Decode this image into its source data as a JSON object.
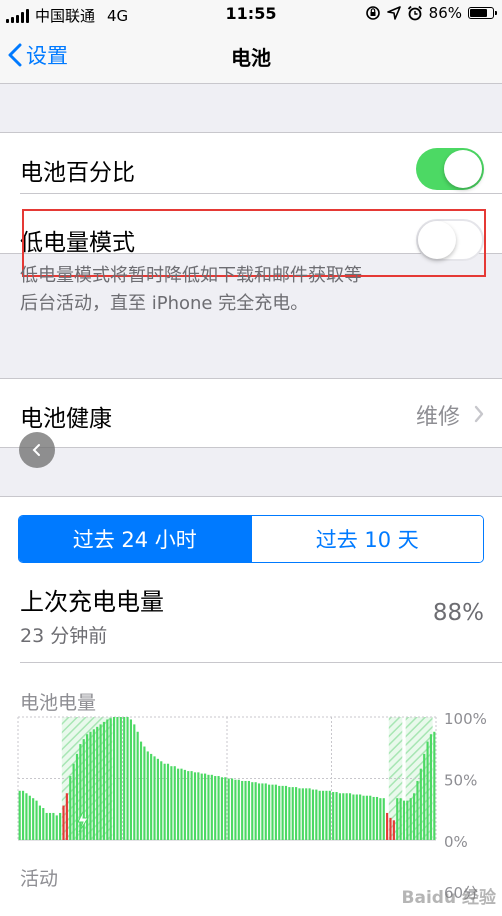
{
  "status_bar": {
    "carrier": "中国联通",
    "network": "4G",
    "time": "11:55",
    "battery_percent": "86%",
    "battery_level": 0.86
  },
  "nav": {
    "back_label": "设置",
    "title": "电池"
  },
  "settings": {
    "battery_percentage_label": "电池百分比",
    "battery_percentage_on": true,
    "low_power_label": "低电量模式",
    "low_power_on": false,
    "low_power_footnote_line1": "低电量模式将暂时降低如下载和邮件获取等",
    "low_power_footnote_line2": "后台活动，直至 iPhone 完全充电。",
    "battery_health_label": "电池健康",
    "battery_health_value": "维修"
  },
  "usage": {
    "segments": [
      "过去 24 小时",
      "过去 10 天"
    ],
    "selected_segment": 0,
    "last_charge_title": "上次充电电量",
    "last_charge_time": "23 分钟前",
    "last_charge_value": "88%",
    "battery_level_label": "电池电量",
    "activity_label": "活动",
    "activity_axis_top": "60分",
    "watermark": "Baidu 经验"
  },
  "colors": {
    "accent": "#007aff",
    "toggle_on": "#4cd964",
    "bar_green": "#4cd964",
    "bar_low": "#e53935",
    "highlight_box": "#e53935"
  },
  "chart_data": {
    "type": "bar",
    "title": "电池电量",
    "y_tick_labels": [
      "100%",
      "50%",
      "0%"
    ],
    "ylim": [
      0,
      100
    ],
    "values": [
      40,
      40,
      38,
      36,
      34,
      32,
      28,
      26,
      22,
      22,
      22,
      20,
      22,
      28,
      38,
      52,
      62,
      70,
      78,
      82,
      86,
      88,
      90,
      92,
      94,
      96,
      98,
      99,
      100,
      100,
      100,
      100,
      100,
      98,
      94,
      88,
      80,
      76,
      72,
      70,
      68,
      66,
      64,
      62,
      62,
      60,
      60,
      58,
      58,
      57,
      56,
      56,
      55,
      55,
      54,
      54,
      53,
      53,
      52,
      52,
      51,
      51,
      50,
      50,
      49,
      49,
      48,
      48,
      48,
      47,
      47,
      46,
      46,
      46,
      45,
      45,
      45,
      44,
      44,
      44,
      43,
      43,
      43,
      42,
      42,
      42,
      42,
      41,
      41,
      40,
      40,
      40,
      40,
      39,
      39,
      38,
      38,
      38,
      38,
      37,
      37,
      37,
      36,
      36,
      36,
      35,
      35,
      34,
      34,
      22,
      18,
      16,
      34,
      34,
      32,
      32,
      34,
      38,
      48,
      58,
      70,
      80,
      86,
      88
    ],
    "low_indices": [
      13,
      14,
      109,
      110,
      111
    ],
    "charging_ranges": [
      [
        13,
        28
      ],
      [
        110,
        114
      ],
      [
        115,
        123
      ]
    ],
    "grid": true
  }
}
